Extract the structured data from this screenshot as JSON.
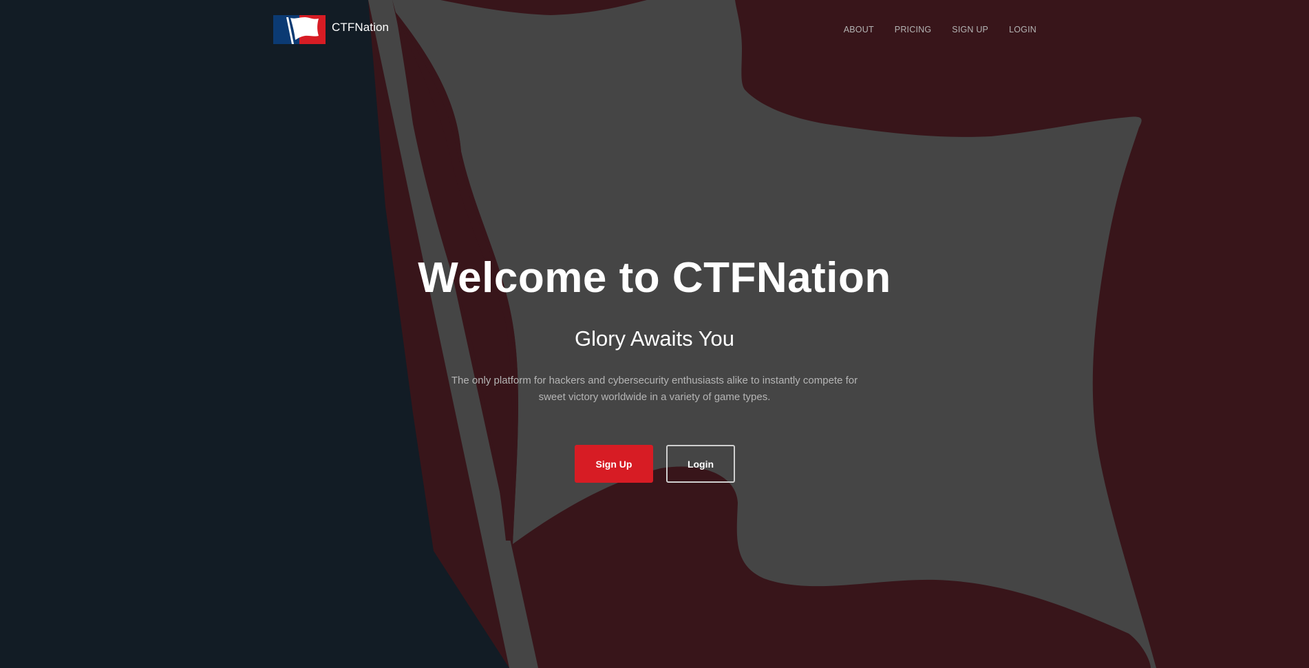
{
  "brand": {
    "name": "CTFNation",
    "logo_icon": "flag-logo-icon"
  },
  "nav": {
    "links": [
      {
        "label": "ABOUT"
      },
      {
        "label": "PRICING"
      },
      {
        "label": "SIGN UP"
      },
      {
        "label": "LOGIN"
      }
    ]
  },
  "hero": {
    "title": "Welcome to CTFNation",
    "subtitle": "Glory Awaits You",
    "description": "The only platform for hackers and cybersecurity enthusiasts alike to instantly compete for sweet victory worldwide in a variety of game types.",
    "primary_button": "Sign Up",
    "secondary_button": "Login"
  },
  "colors": {
    "dark_navy": "#121c25",
    "maroon": "#38151a",
    "flag_gray": "#454545",
    "accent_red": "#d71c24",
    "logo_blue": "#0b3a73"
  },
  "background_icon": "waving-flag-illustration"
}
